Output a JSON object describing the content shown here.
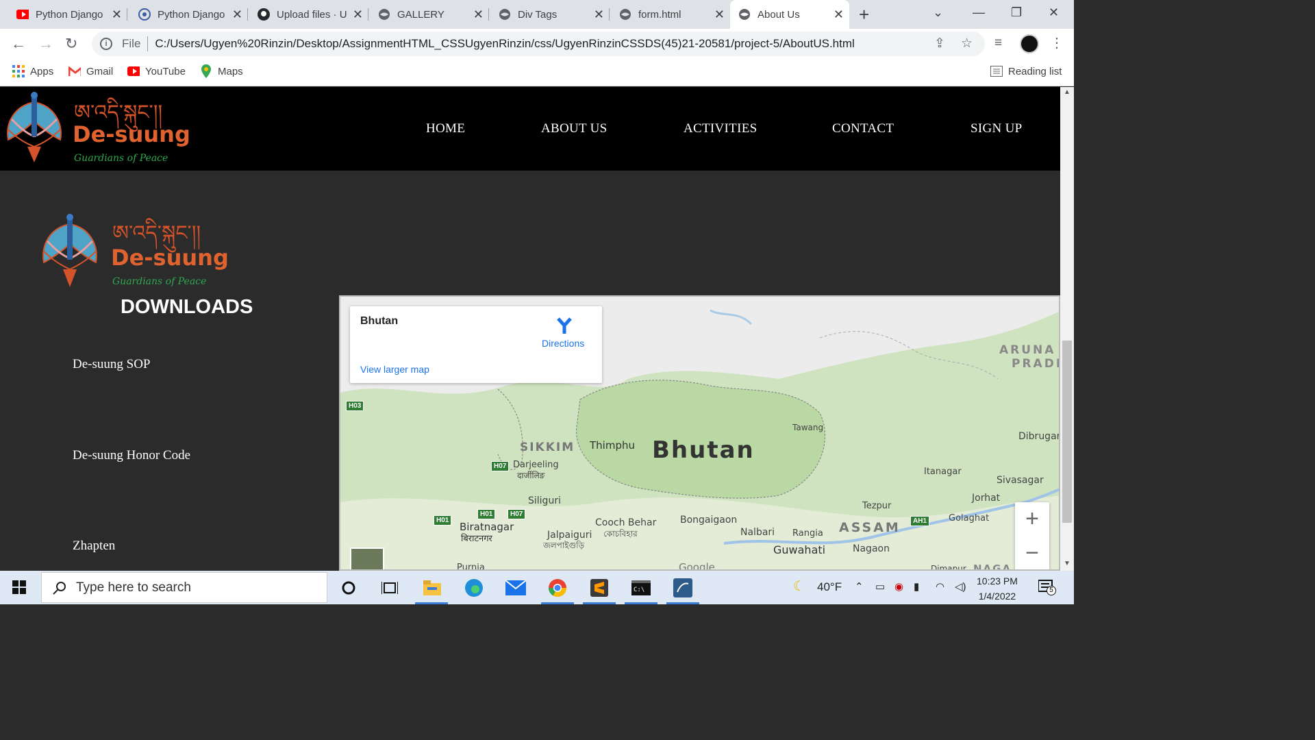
{
  "browser": {
    "tabs": [
      {
        "title": "Python Django",
        "icon": "youtube-icon"
      },
      {
        "title": "Python Django",
        "icon": "python-icon"
      },
      {
        "title": "Upload files · U",
        "icon": "github-icon"
      },
      {
        "title": "GALLERY",
        "icon": "globe-icon"
      },
      {
        "title": "Div Tags",
        "icon": "globe-icon"
      },
      {
        "title": "form.html",
        "icon": "globe-icon"
      },
      {
        "title": "About Us",
        "icon": "globe-icon",
        "active": true
      }
    ],
    "address": {
      "scheme_label": "File",
      "url": "C:/Users/Ugyen%20Rinzin/Desktop/AssignmentHTML_CSSUgyenRinzin/css/UgyenRinzinCSSDS(45)21-20581/project-5/AboutUS.html"
    },
    "bookmarks": [
      {
        "label": "Apps",
        "icon": "apps-grid-icon"
      },
      {
        "label": "Gmail",
        "icon": "gmail-icon"
      },
      {
        "label": "YouTube",
        "icon": "youtube-icon"
      },
      {
        "label": "Maps",
        "icon": "maps-pin-icon"
      }
    ],
    "reading_list": "Reading list"
  },
  "site": {
    "logo": {
      "tibetan": "ཨ་འདི་སྐུང་།།",
      "brand": "De-suung",
      "tagline": "Guardians of Peace"
    },
    "nav": [
      "HOME",
      "ABOUT US",
      "ACTIVITIES",
      "CONTACT",
      "SIGN UP"
    ],
    "downloads_heading": "DOWNLOADS",
    "downloads": [
      "De-suung SOP",
      "De-suung Honor Code",
      "Zhapten"
    ],
    "map": {
      "place": "Bhutan",
      "directions": "Directions",
      "view_larger": "View larger map",
      "labels": {
        "bhutan": "Bhutan",
        "thimphu": "Thimphu",
        "sikkim": "SIKKIM",
        "darjeeling": "Darjeeling",
        "darjeeling_local": "दार्जीलिङ",
        "siliguri": "Siliguri",
        "biratnagar": "Biratnagar",
        "biratnagar_local": "बिराटनगर",
        "jalpaiguri": "Jalpaiguri",
        "jalpaiguri_local": "জলপাইগুড়ি",
        "cooch_behar": "Cooch Behar",
        "cooch_behar_local": "কোচবিহার",
        "bongaigaon": "Bongaigaon",
        "nalbari": "Nalbari",
        "rangia": "Rangia",
        "guwahati": "Guwahati",
        "nagaon": "Nagaon",
        "assam": "ASSAM",
        "tezpur": "Tezpur",
        "tawang": "Tawang",
        "itanagar": "Itanagar",
        "dibrugarh": "Dibrugar",
        "sivasagar": "Sivasagar",
        "jorhat": "Jorhat",
        "golaghat": "Golaghat",
        "arunachal_1": "ARUNA",
        "arunachal_2": "PRADI",
        "purnia": "Purnia",
        "dimapur": "Dimapur",
        "naga": "NAGA",
        "google": "Google"
      },
      "highways": [
        "H03",
        "H07",
        "H01",
        "H01",
        "H07",
        "AH1"
      ]
    }
  },
  "taskbar": {
    "search_placeholder": "Type here to search",
    "weather": "40°F",
    "time": "10:23 PM",
    "date": "1/4/2022",
    "notifications": "5"
  }
}
